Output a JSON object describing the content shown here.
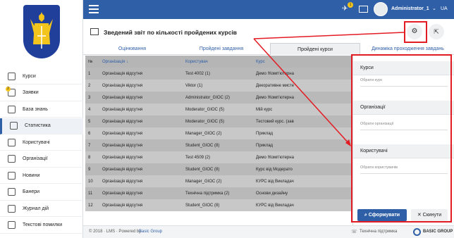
{
  "sidebar": {
    "items": [
      {
        "label": "Курси",
        "icon": "book-icon"
      },
      {
        "label": "Заявки",
        "icon": "requests-icon",
        "badge": "2"
      },
      {
        "label": "База знань",
        "icon": "knowledge-icon"
      },
      {
        "label": "Статистика",
        "icon": "chart-icon"
      },
      {
        "label": "Користувачі",
        "icon": "user-icon"
      },
      {
        "label": "Організації",
        "icon": "building-icon"
      },
      {
        "label": "Новини",
        "icon": "news-icon"
      },
      {
        "label": "Банери",
        "icon": "banner-icon"
      },
      {
        "label": "Журнал дій",
        "icon": "log-icon"
      },
      {
        "label": "Текстові помилки",
        "icon": "error-icon"
      }
    ]
  },
  "topbar": {
    "user": "Administrator_1",
    "lang": "UA",
    "notif_count": "1"
  },
  "page": {
    "title": "Зведений звіт по кількості пройдених курсів"
  },
  "tabs": [
    "Оцінювання",
    "Пройдені завдання",
    "Пройдені курси",
    "Динаміка проходження завдань"
  ],
  "table": {
    "headers": [
      "№",
      "Організація ↓",
      "Користувач",
      "Курс"
    ],
    "rows": [
      [
        "1",
        "Організація відсутня",
        "Test 4002 (1)",
        "Демо !Комп'ютерна"
      ],
      [
        "2",
        "Організація відсутня",
        "Viktor (1)",
        "Декоративне мисте"
      ],
      [
        "3",
        "Організація відсутня",
        "Administrator_GIOC (2)",
        "Демо !Комп'ютерна"
      ],
      [
        "4",
        "Організація відсутня",
        "Moderator_GIOC (5)",
        "Мій курс"
      ],
      [
        "5",
        "Організація відсутня",
        "Moderator_GIOC (5)",
        "Тестовий курс. (зав"
      ],
      [
        "6",
        "Організація відсутня",
        "Manager_GIOC (2)",
        "Приклад"
      ],
      [
        "7",
        "Організація відсутня",
        "Student_GIOC (8)",
        "Приклад"
      ],
      [
        "8",
        "Організація відсутня",
        "Test 4509 (2)",
        "Демо !Комп'ютерна"
      ],
      [
        "9",
        "Організація відсутня",
        "Student_GIOC (8)",
        "Курс від Модерато"
      ],
      [
        "10",
        "Організація відсутня",
        "Manager_GIOC (2)",
        "КУРС від Викладач"
      ],
      [
        "11",
        "Організація відсутня",
        "Технічна підтримка (2)",
        "Основи дизайну"
      ],
      [
        "12",
        "Організація відсутня",
        "Student_GIOC (8)",
        "КУРС від Викладач"
      ]
    ]
  },
  "filter": {
    "sections": [
      {
        "title": "Курси",
        "placeholder": "Обрати курс"
      },
      {
        "title": "Організації",
        "placeholder": "Обрати організації"
      },
      {
        "title": "Користувачі",
        "placeholder": "Обрати користувачів"
      }
    ],
    "apply": "Сформувати",
    "reset": "Скинути"
  },
  "footer": {
    "copyright": "© 2018 · LMS · Powered by",
    "brand": "Basic Group",
    "support": "Технічна підтримка",
    "logo": "BASIC GROUP"
  },
  "colors": {
    "primary": "#2f5fa7",
    "highlight": "#e31b23",
    "row_odd": "#b9b9b9",
    "row_even": "#c8c8c8"
  }
}
